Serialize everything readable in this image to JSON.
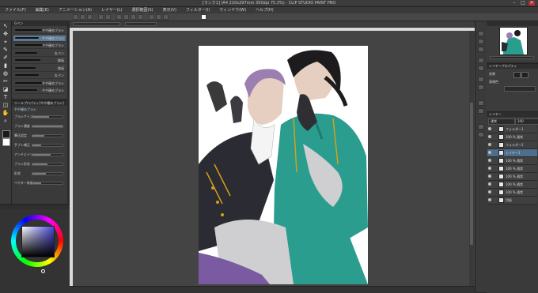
{
  "title_bar": {
    "title": "[ランク1] (A4 210x297mm 350dpi 75.3%) - CLIP STUDIO PAINT PRO",
    "minimize": "–",
    "maximize": "□",
    "close": "✕"
  },
  "menu": [
    "ファイル(F)",
    "編集(E)",
    "アニメーション(A)",
    "レイヤー(L)",
    "選択範囲(S)",
    "表示(V)",
    "フィルター(I)",
    "ウィンドウ(W)",
    "ヘルプ(H)"
  ],
  "sub_tool": {
    "tab": "Gペン",
    "brushes": [
      "やや硬めブラシ",
      "やや硬めブラシ",
      "やや硬めブラシ",
      "丸ペン",
      "線画",
      "線画",
      "丸ペン",
      "やや硬めブラシ",
      "やや硬めブラシ"
    ]
  },
  "tool_property": {
    "tab": "ツールプロパティ[やや硬めブラシ]",
    "brush_name": "やや硬めブラシ",
    "rows": [
      {
        "label": "ブラシサイズ",
        "level": 0.55
      },
      {
        "label": "ブラシ濃度",
        "level": 1.0
      },
      {
        "label": "筆圧設定",
        "level": 0.4
      },
      {
        "label": "手ブレ補正",
        "level": 0.3
      },
      {
        "label": "アンチエイリアス",
        "level": 0.6
      },
      {
        "label": "ブラシ形状",
        "level": 0.5
      },
      {
        "label": "形状",
        "level": 0.45
      },
      {
        "label": "ベクター吸着",
        "level": 0.3
      }
    ]
  },
  "tools": [
    "↖",
    "✥",
    "⌖",
    "✎",
    "✐",
    "▮",
    "◍",
    "✂",
    "◪",
    "T",
    "◫",
    "✋",
    "⌕"
  ],
  "colors": {
    "main": "#4a46d6",
    "canvas_bg": "#444444",
    "ui_dark": "#2b2b2b",
    "selection": "#4d6f8d",
    "jacket": "#2a9d8f",
    "hair_purple": "#9a7fb0",
    "gold_trim": "#d4a017"
  },
  "layer_property": {
    "tab": "レイヤープロパティ",
    "effect": "効果",
    "expression_color": "表現色"
  },
  "layers": {
    "tab": "レイヤー",
    "blend_mode": "通常",
    "opacity": "100",
    "items": [
      {
        "name": "フォルダー1"
      },
      {
        "name": "100 % 通常"
      },
      {
        "name": "フォルダー2"
      },
      {
        "name": "レイヤー1"
      },
      {
        "name": "100 % 通常"
      },
      {
        "name": "100 % 通常"
      },
      {
        "name": "100 % 通常"
      },
      {
        "name": "100 % 通常"
      },
      {
        "name": "100 % 通常"
      },
      {
        "name": "用紙"
      }
    ]
  }
}
